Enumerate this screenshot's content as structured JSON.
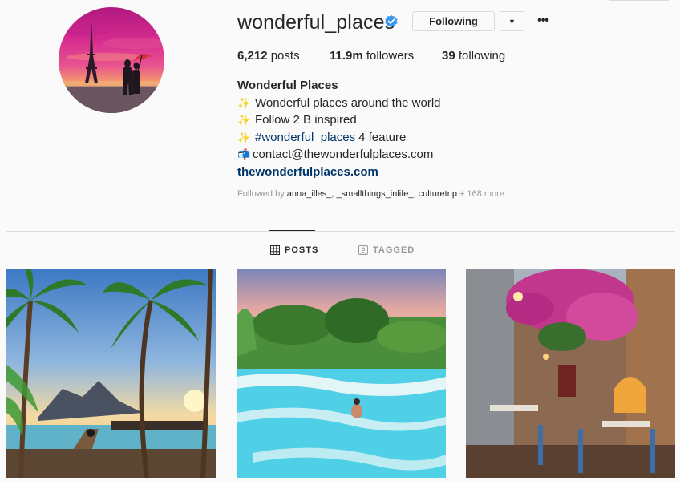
{
  "profile": {
    "username": "wonderful_places",
    "follow_label": "Following",
    "dropdown_glyph": "▼",
    "more_glyph": "•••",
    "stats": {
      "posts_count": "6,212",
      "posts_label": " posts",
      "followers_count": "11.9m",
      "followers_label": " followers",
      "following_count": "39",
      "following_label": " following"
    },
    "bio": {
      "name": "Wonderful Places",
      "line1": "Wonderful places around the world",
      "line2": "Follow 2 B inspired",
      "hashtag": "#wonderful_places",
      "line3_rest": "4 feature",
      "email": "contact@thewonderfulplaces.com",
      "website": "thewonderfulplaces.com",
      "sparkle_glyph": "✨",
      "mail_glyph": "📬"
    },
    "followed_by": {
      "prefix": "Followed by ",
      "names": "anna_illes_, _smallthings_inlife_, culturetrip",
      "suffix": " + 168 more"
    }
  },
  "tabs": {
    "posts": "POSTS",
    "tagged": "TAGGED"
  },
  "colors": {
    "link": "#003569",
    "verified": "#3897f0",
    "text": "#262626",
    "muted": "#999999"
  },
  "icons": [
    "verified-badge-icon",
    "grid-icon",
    "tag-icon",
    "more-options-icon",
    "chevron-down-icon"
  ]
}
